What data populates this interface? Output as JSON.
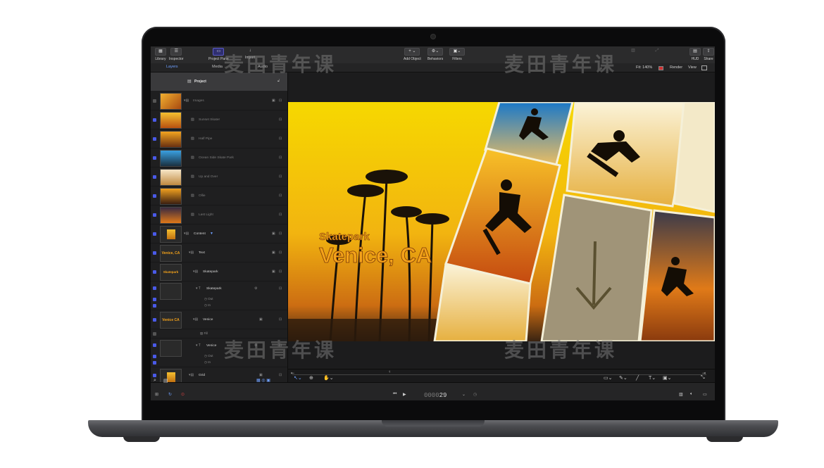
{
  "toolbar": {
    "library": "Library",
    "inspector": "Inspector",
    "project_pane": "Project Pane",
    "import": "Import",
    "add_object": "Add Object",
    "behaviors": "Behaviors",
    "filters": "Filters",
    "hud": "HUD",
    "share": "Share"
  },
  "tabs": {
    "layers": "Layers",
    "media": "Media",
    "audio": "Audio"
  },
  "viewer": {
    "fit": "Fit: 140% ",
    "render": "Render",
    "view": "View"
  },
  "layers": {
    "project": "Project",
    "items": [
      {
        "name": "Images",
        "indent": 0
      },
      {
        "name": "Sunset Skater",
        "indent": 1
      },
      {
        "name": "Half Pipe",
        "indent": 1
      },
      {
        "name": "Ocean Side Skate Park",
        "indent": 1
      },
      {
        "name": "Up and Over",
        "indent": 1
      },
      {
        "name": "Ollie",
        "indent": 1
      },
      {
        "name": "Last Light",
        "indent": 1
      },
      {
        "name": "Content",
        "indent": 0
      },
      {
        "name": "Text",
        "indent": 1
      },
      {
        "name": "Skatepark",
        "indent": 2
      },
      {
        "name": "Skatepark",
        "indent": 3
      },
      {
        "name": "Venice",
        "indent": 2
      },
      {
        "name": "Venice",
        "indent": 3
      },
      {
        "name": "Grid",
        "indent": 1
      }
    ],
    "sub_out": "Out",
    "sub_in": "In",
    "fill": "Fill",
    "thumb_venice_ca": "Venice, CA",
    "thumb_skatepark": "Skatepark",
    "thumb_venice": "Venice CA"
  },
  "canvas": {
    "title_small": "Skatepark",
    "title_large": "Venice, CA"
  },
  "bottom": {
    "timecode_dim": "0000",
    "timecode": "29"
  },
  "watermark": "麦田青年课",
  "colors": {
    "accent": "#6fa0ff",
    "title": "#f4a21a",
    "sky_top": "#f5d400",
    "sky_bottom": "#e08a10"
  }
}
